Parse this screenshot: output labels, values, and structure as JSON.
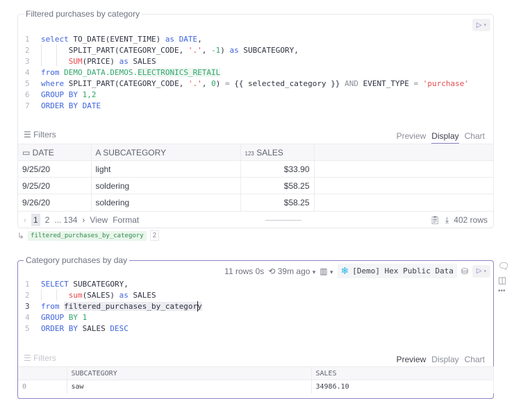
{
  "cell1": {
    "title": "Filtered purchases by category",
    "code": [
      [
        [
          "select ",
          "kw"
        ],
        [
          "TO_DATE(EVENT_TIME) ",
          ""
        ],
        [
          "as ",
          "kw"
        ],
        [
          "DATE",
          "kw"
        ],
        [
          ",",
          ""
        ]
      ],
      [
        [
          "      SPLIT_PART(CATEGORY_CODE, ",
          ""
        ],
        [
          "'.'",
          "st"
        ],
        [
          ", ",
          ""
        ],
        [
          "-1",
          "nm"
        ],
        [
          ") ",
          ""
        ],
        [
          "as ",
          "kw"
        ],
        [
          "SUBCATEGORY,",
          ""
        ]
      ],
      [
        [
          "      ",
          ""
        ],
        [
          "SUM",
          "fn"
        ],
        [
          "(PRICE) ",
          ""
        ],
        [
          "as ",
          "kw"
        ],
        [
          "SALES",
          ""
        ]
      ],
      [
        [
          "from ",
          "kw"
        ],
        [
          "DEMO_DATA.DEMOS.",
          "nm"
        ],
        [
          "ELECTRONICS_RETAIL",
          "tb"
        ]
      ],
      [
        [
          "where ",
          "kw"
        ],
        [
          "SPLIT_PART(CATEGORY_CODE, ",
          ""
        ],
        [
          "'.'",
          "st"
        ],
        [
          ", ",
          ""
        ],
        [
          "0",
          "nm"
        ],
        [
          ") ",
          ""
        ],
        [
          "= ",
          "op"
        ],
        [
          "{{ selected_category }} ",
          ""
        ],
        [
          "AND ",
          "op"
        ],
        [
          "EVENT_TYPE ",
          ""
        ],
        [
          "= ",
          "op"
        ],
        [
          "'purchase'",
          "st"
        ]
      ],
      [
        [
          "GROUP BY ",
          "kw"
        ],
        [
          "1,2",
          "nm"
        ]
      ],
      [
        [
          "ORDER BY DATE",
          "kw"
        ]
      ]
    ],
    "filters_label": "Filters",
    "tabs": [
      "Preview",
      "Display",
      "Chart"
    ],
    "columns": [
      "DATE",
      "SUBCATEGORY",
      "SALES"
    ],
    "column_icons": [
      "calendar-icon",
      "text-type-icon",
      "number-type-icon"
    ],
    "number_icon_text": "123",
    "rows": [
      [
        "9/25/20",
        "light",
        "$33.90"
      ],
      [
        "9/25/20",
        "soldering",
        "$58.25"
      ],
      [
        "9/26/20",
        "soldering",
        "$58.25"
      ]
    ],
    "pagination": {
      "pages": [
        "1",
        "2",
        "...",
        "134"
      ],
      "view": "View",
      "format": "Format"
    },
    "row_count": "402 rows",
    "output_var": "filtered_purchases_by_category",
    "output_ref_count": "2"
  },
  "cell2": {
    "title": "Category purchases by day",
    "status": "11 rows 0s",
    "last_run": "39m ago",
    "connection": "[Demo] Hex Public Data",
    "code": [
      [
        [
          "SELECT ",
          "kw"
        ],
        [
          "SUBCATEGORY,",
          ""
        ]
      ],
      [
        [
          "      ",
          ""
        ],
        [
          "sum",
          "fn"
        ],
        [
          "(SALES) ",
          ""
        ],
        [
          "as ",
          "kw"
        ],
        [
          "SALES",
          ""
        ]
      ],
      [
        [
          "from ",
          "kw"
        ],
        [
          "filtered_purchases_by_category",
          "hl"
        ]
      ],
      [
        [
          "GROUP ",
          "kw"
        ],
        [
          "BY ",
          "nm"
        ],
        [
          "1",
          "nm"
        ]
      ],
      [
        [
          "ORDER BY ",
          "kw"
        ],
        [
          "SALES ",
          ""
        ],
        [
          "DESC",
          "kw"
        ]
      ]
    ],
    "filters_label": "Filters",
    "tabs": [
      "Preview",
      "Display",
      "Chart"
    ],
    "columns": [
      "",
      "SUBCATEGORY",
      "SALES"
    ],
    "rows": [
      [
        "0",
        "saw",
        "34986.10"
      ]
    ]
  },
  "colors": {
    "accent": "#8d84c4",
    "keyword": "#3e63dd",
    "string": "#e5484d",
    "number": "#30a46c"
  }
}
